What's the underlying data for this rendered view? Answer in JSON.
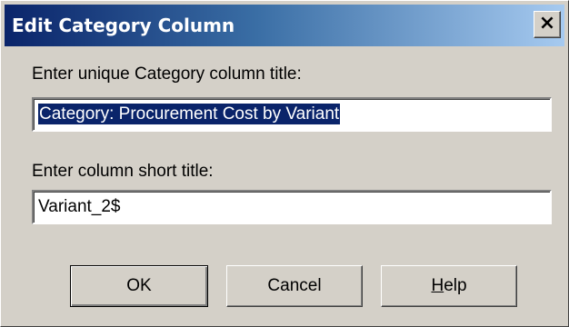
{
  "dialog": {
    "title": "Edit Category Column",
    "close_glyph": "×",
    "title_label": "Enter unique Category column title:",
    "title_value": "Category:  Procurement Cost by Variant",
    "short_label": "Enter column short title:",
    "short_value": "Variant_2$"
  },
  "buttons": {
    "ok": "OK",
    "cancel": "Cancel",
    "help_mnemonic": "H",
    "help_rest": "elp"
  },
  "colors": {
    "titlebar_start": "#0a246a",
    "titlebar_end": "#a6caf0",
    "face": "#d4d0c8",
    "selection": "#0a246a"
  }
}
